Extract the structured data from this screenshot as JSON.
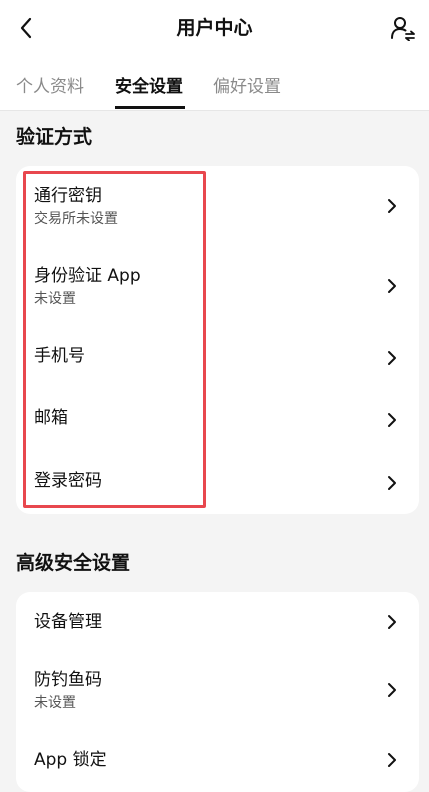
{
  "header": {
    "title": "用户中心",
    "back_icon": "chevron-left-icon",
    "user_icon": "user-switch-icon"
  },
  "tabs": [
    {
      "label": "个人资料",
      "active": false
    },
    {
      "label": "安全设置",
      "active": true
    },
    {
      "label": "偏好设置",
      "active": false
    }
  ],
  "verification": {
    "title": "验证方式",
    "items": [
      {
        "label": "通行密钥",
        "sub": "交易所未设置"
      },
      {
        "label": "身份验证 App",
        "sub": "未设置"
      },
      {
        "label": "手机号",
        "sub": ""
      },
      {
        "label": "邮箱",
        "sub": ""
      },
      {
        "label": "登录密码",
        "sub": ""
      }
    ]
  },
  "advanced": {
    "title": "高级安全设置",
    "items": [
      {
        "label": "设备管理",
        "sub": ""
      },
      {
        "label": "防钓鱼码",
        "sub": "未设置"
      },
      {
        "label": "App 锁定",
        "sub": ""
      }
    ]
  },
  "colors": {
    "highlight": "#e8474e",
    "background": "#f4f4f4"
  }
}
